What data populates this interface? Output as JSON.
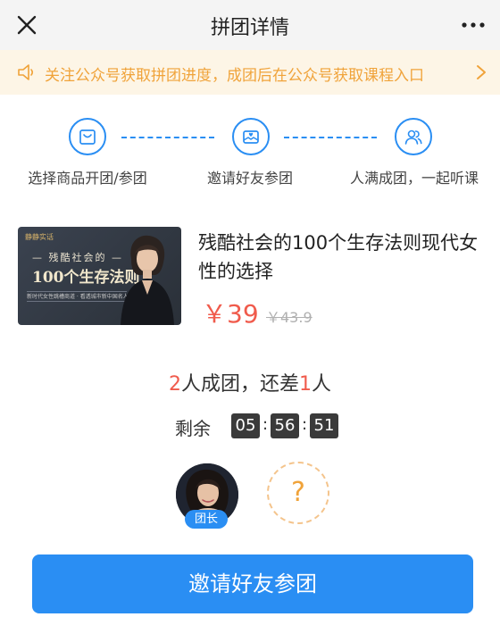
{
  "header": {
    "title": "拼团详情",
    "close_icon": "close-icon",
    "more_icon": "more-icon"
  },
  "notice": {
    "text": "关注公众号获取拼团进度，成团后在公众号获取课程入口",
    "icon": "speaker-icon",
    "color": "#f0a33a"
  },
  "steps": [
    {
      "label": "选择商品开团/参团",
      "icon": "shopping-bag-icon"
    },
    {
      "label": "邀请好友参团",
      "icon": "invite-envelope-icon"
    },
    {
      "label": "人满成团，一起听课",
      "icon": "users-icon"
    }
  ],
  "product": {
    "name": "残酷社会的100个生存法则现代女性的选择",
    "price": "￥39",
    "original_price": "￥43.9",
    "cover": {
      "brand": "静静实话",
      "title_line1": "— 残酷社会的 —",
      "title_line2": "100个生存法则",
      "subtitle": "新时代女性跳槽商道 · 看透城市新中国名人榜"
    }
  },
  "group": {
    "required": "2",
    "status_mid": "人成团，还差",
    "missing": "1",
    "status_end": "人",
    "remaining_label": "剩余",
    "countdown": {
      "hours": "05",
      "minutes": "56",
      "seconds": "51",
      "separator": ":"
    }
  },
  "members": {
    "leader_badge": "团长",
    "empty_slot": "?"
  },
  "invite_button": "邀请好友参团",
  "colors": {
    "accent": "#2a8ef3",
    "price": "#f05b4c",
    "notice_bg": "#fdf5e6"
  }
}
